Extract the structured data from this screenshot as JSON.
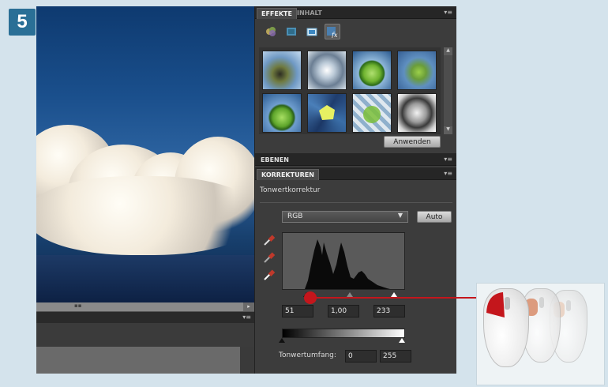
{
  "step_number": "5",
  "panel": {
    "effects_tabs": [
      {
        "label": "EFFEKTE",
        "active": true
      },
      {
        "label": "INHALT",
        "active": false
      }
    ],
    "effects_icons": [
      "filter-icon",
      "layer-style-icon",
      "photo-effect-icon",
      "fx-icon"
    ],
    "thumbnails": [
      "filter-thumb-1",
      "filter-thumb-2",
      "filter-thumb-3",
      "filter-thumb-4",
      "filter-thumb-5",
      "filter-thumb-6",
      "filter-thumb-7",
      "filter-thumb-8"
    ],
    "apply_button": "Anwenden",
    "layers_tab": "EBENEN",
    "corrections_tab": "KORREKTUREN",
    "corrections_title": "Tonwertkorrektur",
    "channel_select": "RGB",
    "auto_button": "Auto",
    "input_values": {
      "black": "51",
      "gamma": "1,00",
      "white": "233"
    },
    "output_label": "Tonwertumfang:",
    "output_values": {
      "min": "0",
      "max": "255"
    }
  },
  "colors": {
    "accent_red": "#c4161c",
    "badge_blue": "#2a6f96"
  }
}
